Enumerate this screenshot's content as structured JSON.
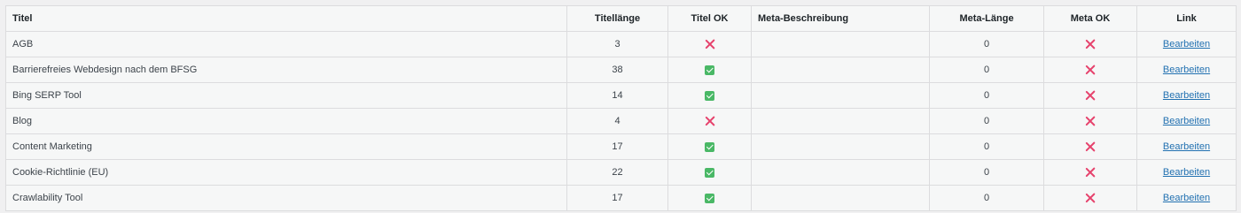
{
  "table": {
    "headers": {
      "title": "Titel",
      "title_length": "Titellänge",
      "title_ok": "Titel OK",
      "meta_description": "Meta-Beschreibung",
      "meta_length": "Meta-Länge",
      "meta_ok": "Meta OK",
      "link": "Link"
    },
    "rows": [
      {
        "title": "AGB",
        "title_length": "3",
        "title_ok": false,
        "meta_description": "",
        "meta_length": "0",
        "meta_ok": false,
        "link": "Bearbeiten"
      },
      {
        "title": "Barrierefreies Webdesign nach dem BFSG",
        "title_length": "38",
        "title_ok": true,
        "meta_description": "",
        "meta_length": "0",
        "meta_ok": false,
        "link": "Bearbeiten"
      },
      {
        "title": "Bing SERP Tool",
        "title_length": "14",
        "title_ok": true,
        "meta_description": "",
        "meta_length": "0",
        "meta_ok": false,
        "link": "Bearbeiten"
      },
      {
        "title": "Blog",
        "title_length": "4",
        "title_ok": false,
        "meta_description": "",
        "meta_length": "0",
        "meta_ok": false,
        "link": "Bearbeiten"
      },
      {
        "title": "Content Marketing",
        "title_length": "17",
        "title_ok": true,
        "meta_description": "",
        "meta_length": "0",
        "meta_ok": false,
        "link": "Bearbeiten"
      },
      {
        "title": "Cookie-Richtlinie (EU)",
        "title_length": "22",
        "title_ok": true,
        "meta_description": "",
        "meta_length": "0",
        "meta_ok": false,
        "link": "Bearbeiten"
      },
      {
        "title": "Crawlability Tool",
        "title_length": "17",
        "title_ok": true,
        "meta_description": "",
        "meta_length": "0",
        "meta_ok": false,
        "link": "Bearbeiten"
      }
    ]
  },
  "icons": {
    "ok": "check-square-icon",
    "not_ok": "cross-icon"
  },
  "colors": {
    "ok": "#4ab866",
    "not_ok": "#e6436d",
    "link": "#2271b1"
  }
}
